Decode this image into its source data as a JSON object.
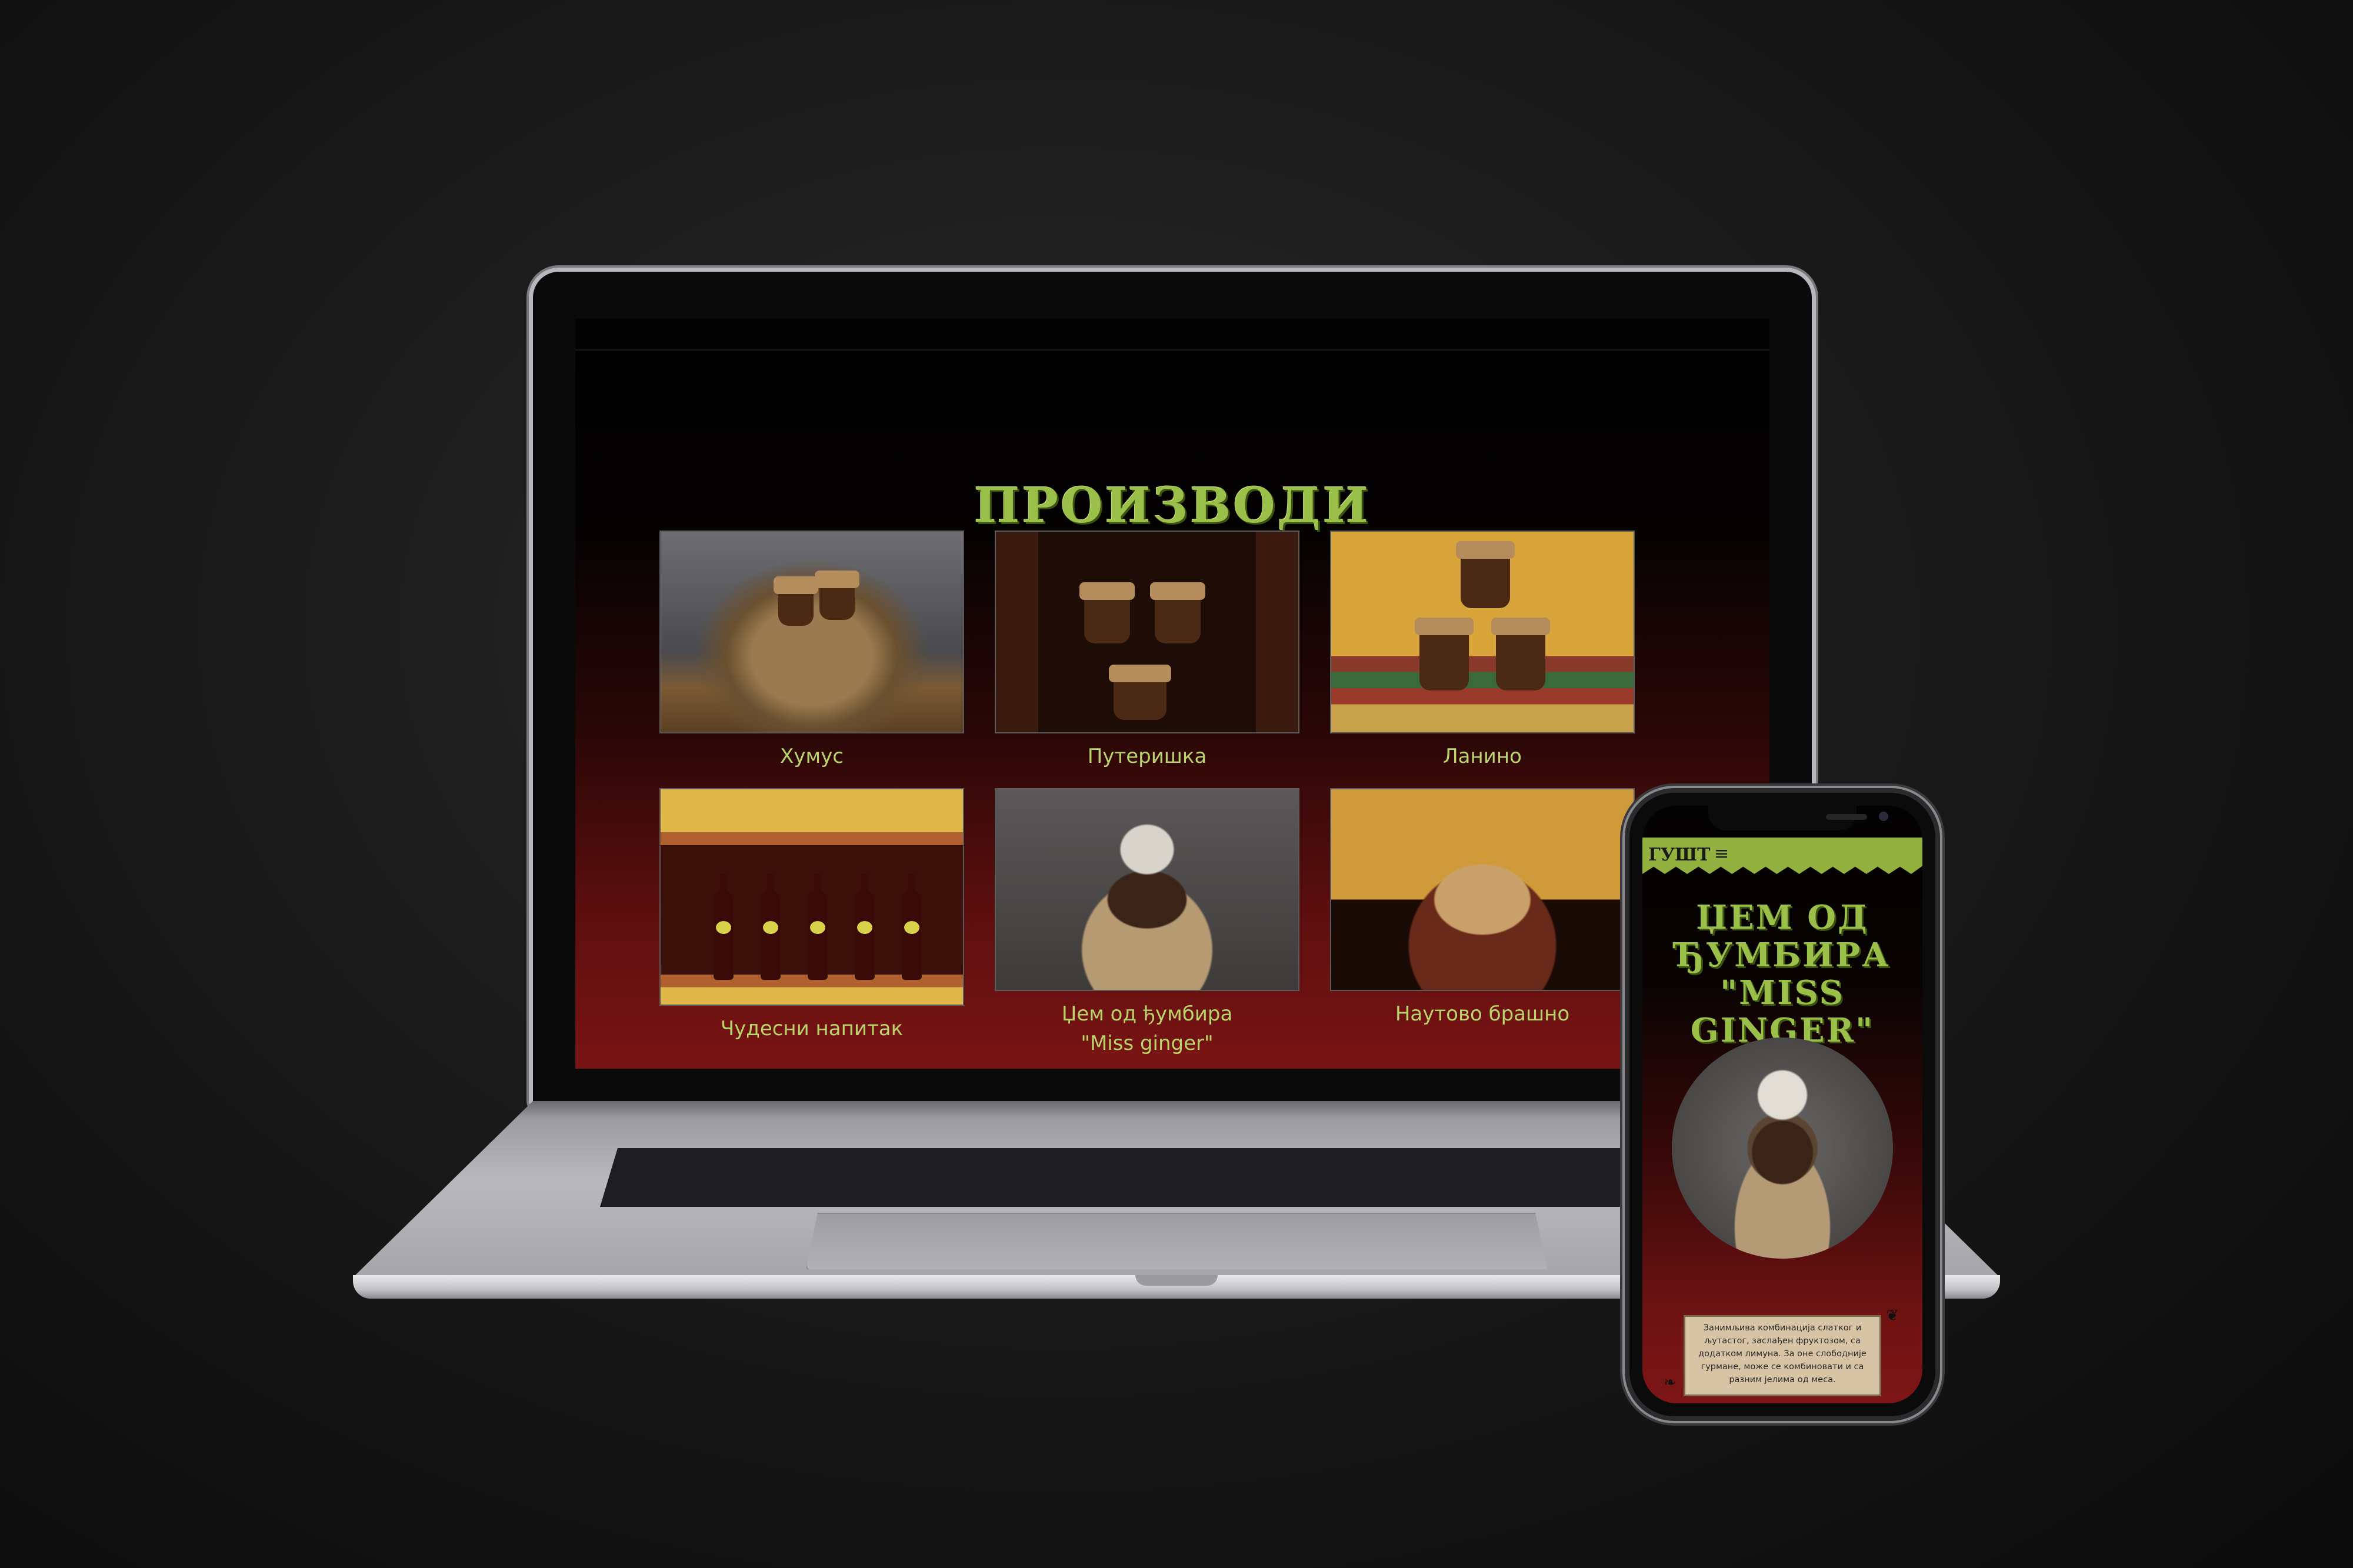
{
  "laptop": {
    "section_title": "ПРОИЗВОДИ",
    "products": [
      {
        "label": "Хумус"
      },
      {
        "label": "Путеришка"
      },
      {
        "label": "Ланино"
      },
      {
        "label": "Чудесни напитак"
      },
      {
        "label": "Џем од ђумбира\n\"Miss ginger\""
      },
      {
        "label": "Наутово брашно"
      }
    ]
  },
  "phone": {
    "logo": "ГУШТ",
    "menu_icon": "≡",
    "product_title": "ЏЕМ ОД\nЂУМБИРА\n\"MISS GINGER\"",
    "description": "Занимљива комбинација слатког и љутастог, заслађен фруктозом, са додатком лимуна. За оне слободније гурмане, може се комбиновати и са разним јелима од меса."
  },
  "colors": {
    "accent_green": "#9bc04a",
    "bg_dark_red": "#7a1414"
  }
}
